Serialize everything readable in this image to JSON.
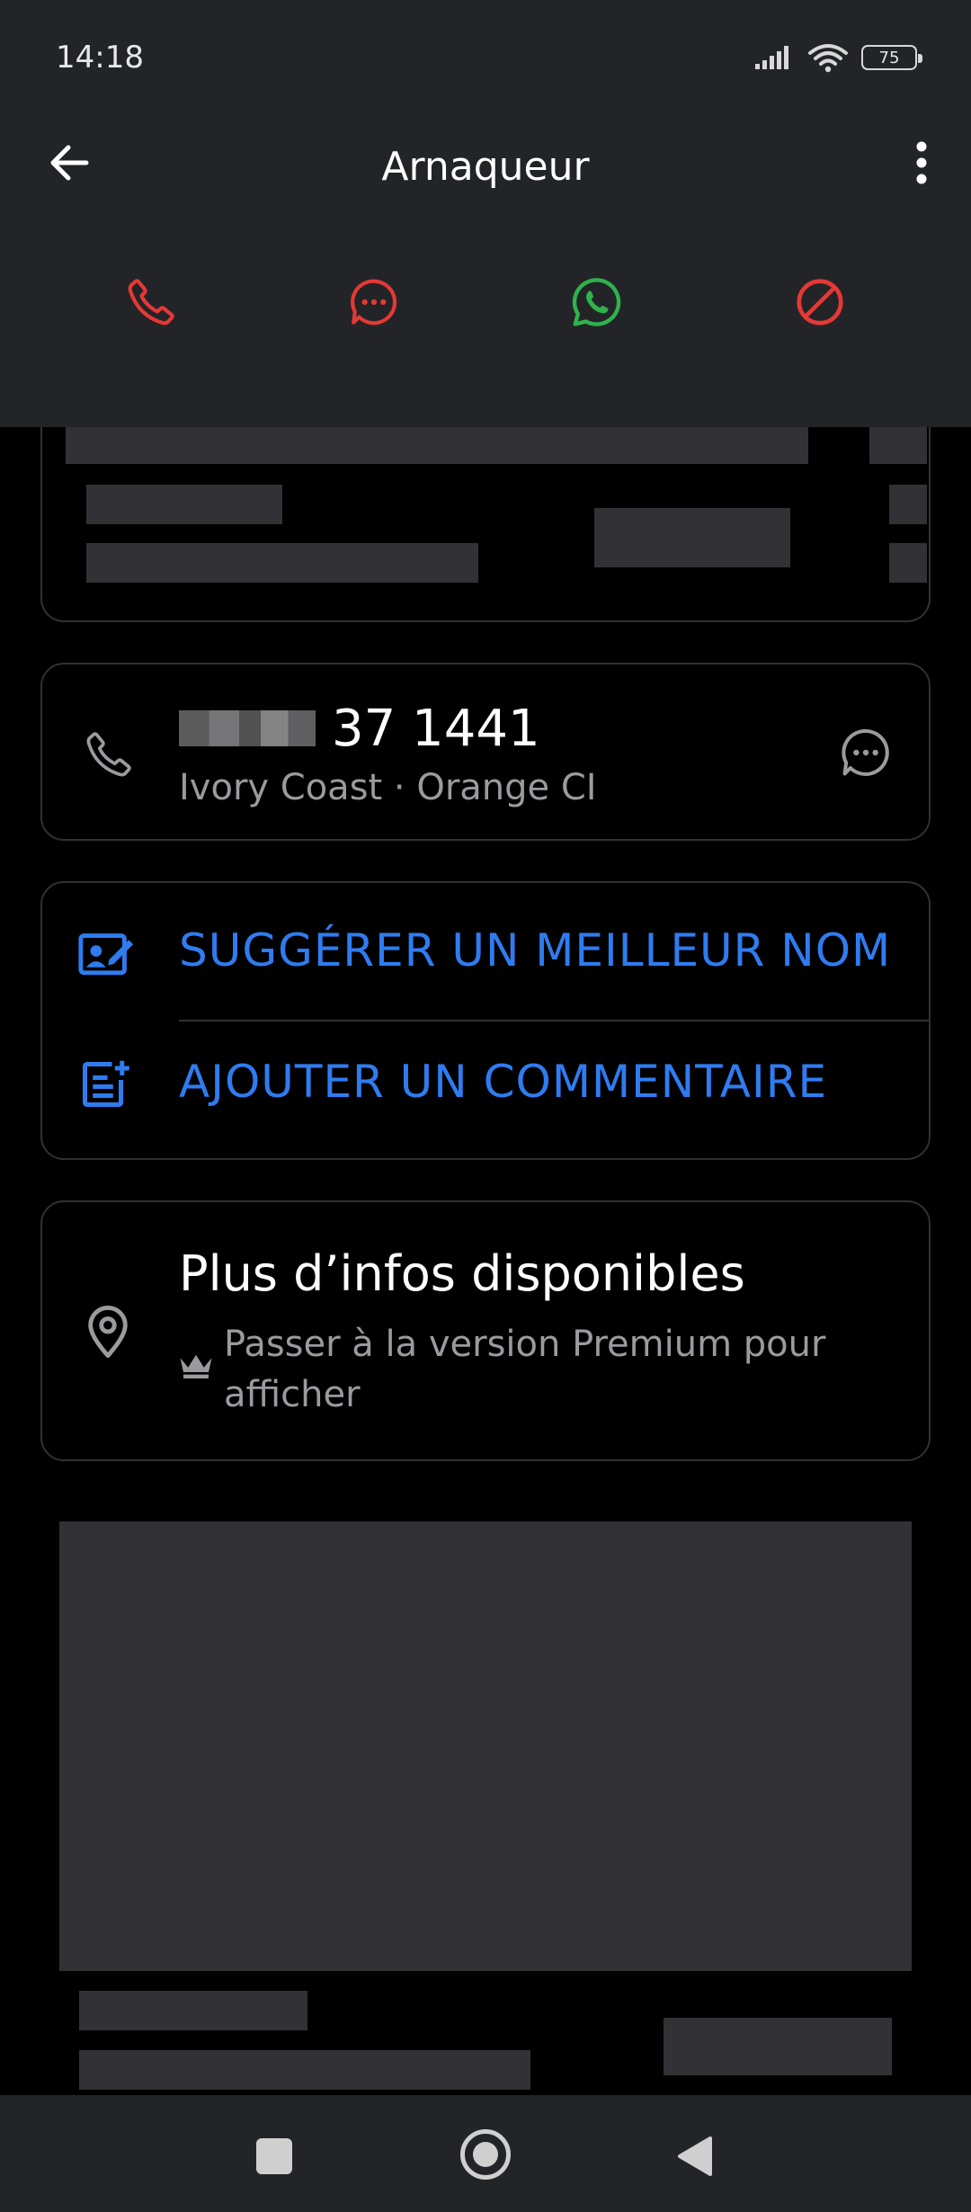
{
  "status": {
    "time": "14:18",
    "battery": "75"
  },
  "header": {
    "title": "Arnaqueur"
  },
  "phone": {
    "number": "37 1441",
    "carrier": "Ivory Coast · Orange CI"
  },
  "actions": {
    "suggest_label": "SUGGÉRER UN MEILLEUR NOM",
    "comment_label": "AJOUTER UN COMMENTAIRE"
  },
  "info": {
    "title": "Plus d’infos disponibles",
    "subtitle": "Passer à la version Premium pour afficher"
  },
  "colors": {
    "accent_red": "#e53935",
    "whatsapp_green": "#2fb24c",
    "link_blue": "#2f7cf0",
    "bar_bg": "#232428"
  },
  "icons": [
    "back-arrow-icon",
    "more-vert-icon",
    "phone-icon",
    "message-icon",
    "whatsapp-icon",
    "block-icon",
    "chat-bubble-icon",
    "edit-contact-icon",
    "add-note-icon",
    "location-pin-icon",
    "crown-icon"
  ]
}
